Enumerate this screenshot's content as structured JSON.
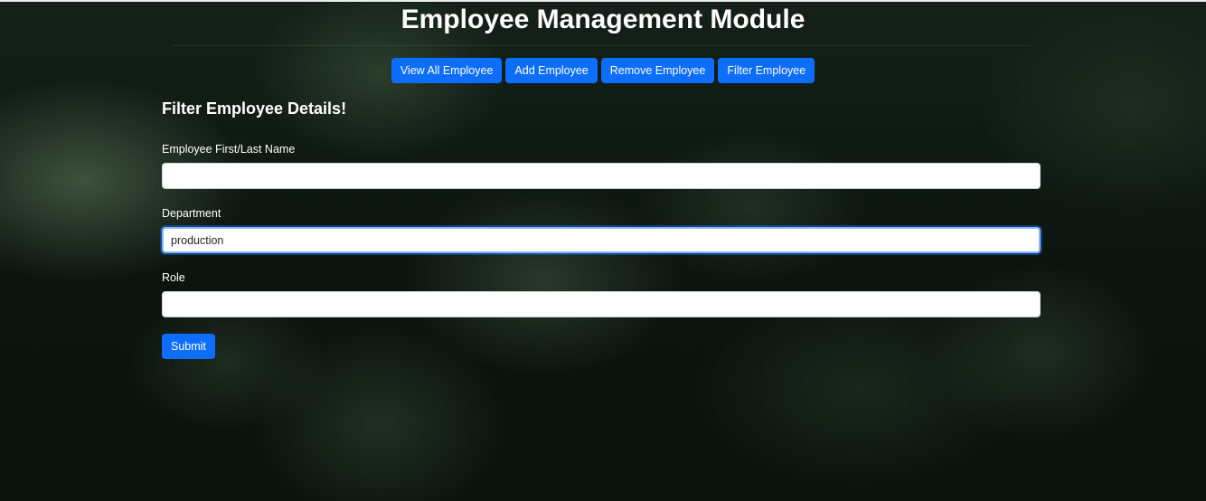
{
  "page": {
    "title": "Employee Management Module"
  },
  "nav": {
    "buttons": [
      {
        "label": "View All Employee"
      },
      {
        "label": "Add Employee"
      },
      {
        "label": "Remove Employee"
      },
      {
        "label": "Filter Employee"
      }
    ]
  },
  "form": {
    "heading": "Filter Employee Details!",
    "name_field": {
      "label": "Employee First/Last Name",
      "value": ""
    },
    "department_field": {
      "label": "Department",
      "value": "production"
    },
    "role_field": {
      "label": "Role",
      "value": ""
    },
    "submit_label": "Submit"
  },
  "colors": {
    "primary": "#0d6efd",
    "background": "#0d1510",
    "text": "#ffffff"
  }
}
